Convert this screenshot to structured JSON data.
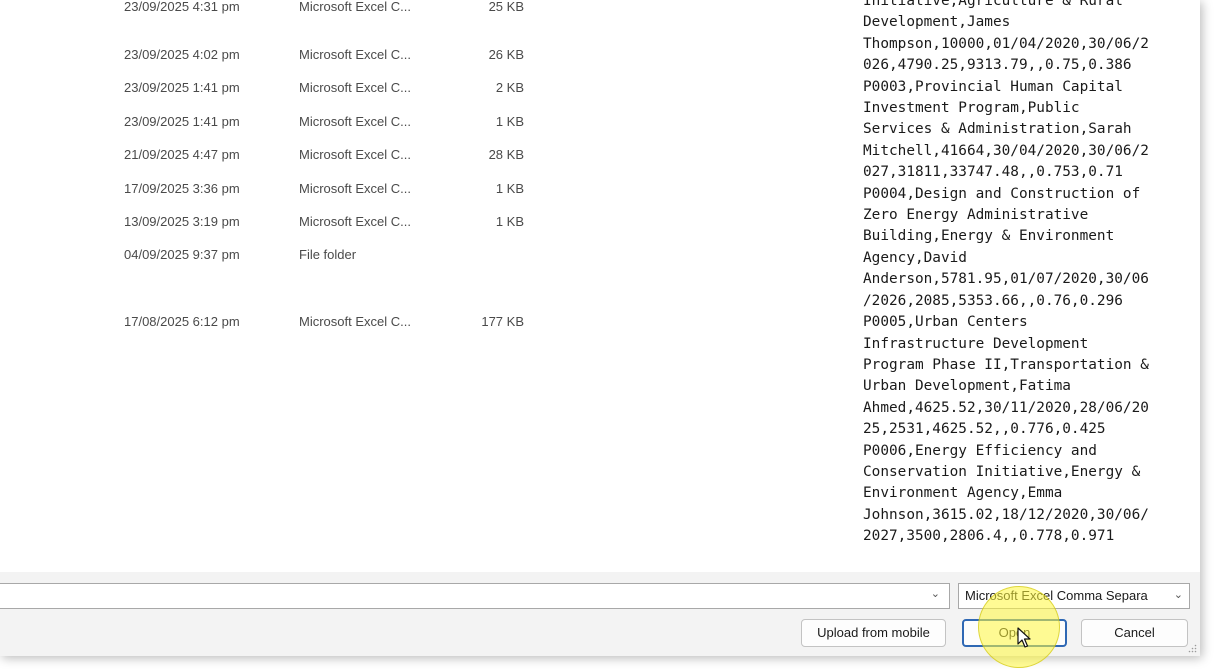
{
  "files": [
    {
      "date": "23/09/2025 4:31 pm",
      "type": "Microsoft Excel C...",
      "size": "25 KB"
    },
    {
      "date": "23/09/2025 4:02 pm",
      "type": "Microsoft Excel C...",
      "size": "26 KB"
    },
    {
      "date": "23/09/2025 1:41 pm",
      "type": "Microsoft Excel C...",
      "size": "2 KB"
    },
    {
      "date": "23/09/2025 1:41 pm",
      "type": "Microsoft Excel C...",
      "size": "1 KB"
    },
    {
      "date": "21/09/2025 4:47 pm",
      "type": "Microsoft Excel C...",
      "size": "28 KB"
    },
    {
      "date": "17/09/2025 3:36 pm",
      "type": "Microsoft Excel C...",
      "size": "1 KB"
    },
    {
      "date": "13/09/2025 3:19 pm",
      "type": "Microsoft Excel C...",
      "size": "1 KB"
    },
    {
      "date": "04/09/2025 9:37 pm",
      "type": "File folder",
      "size": ""
    },
    {
      "date": "17/08/2025 6:12 pm",
      "type": "Microsoft Excel C...",
      "size": "177 KB"
    }
  ],
  "preview": {
    "lines": [
      "Initiative,Agriculture & Rural",
      "Development,James",
      "Thompson,10000,01/04/2020,30/06/2",
      "026,4790.25,9313.79,,0.75,0.386",
      "P0003,Provincial Human Capital",
      "Investment Program,Public",
      "Services & Administration,Sarah",
      "Mitchell,41664,30/04/2020,30/06/2",
      "027,31811,33747.48,,0.753,0.71",
      "P0004,Design and Construction of",
      "Zero Energy Administrative",
      "Building,Energy & Environment",
      "Agency,David",
      "Anderson,5781.95,01/07/2020,30/06",
      "/2026,2085,5353.66,,0.76,0.296",
      "P0005,Urban Centers",
      "Infrastructure Development",
      "Program Phase II,Transportation &",
      "Urban Development,Fatima",
      "Ahmed,4625.52,30/11/2020,28/06/20",
      "25,2531,4625.52,,0.776,0.425",
      "P0006,Energy Efficiency and",
      "Conservation Initiative,Energy &",
      "Environment Agency,Emma",
      "Johnson,3615.02,18/12/2020,30/06/",
      "2027,3500,2806.4,,0.778,0.971"
    ]
  },
  "filename": {
    "value": ""
  },
  "filetype": {
    "selected": "Microsoft Excel Comma Separa"
  },
  "buttons": {
    "upload": "Upload from mobile",
    "open": "Open",
    "cancel": "Cancel"
  },
  "colors": {
    "accent": "#2f68b4",
    "highlight": "#fff83c"
  },
  "icons": {
    "dropdown": "chevron-down-icon",
    "cursor": "mouse-pointer-icon",
    "resize": "resize-grip-icon"
  }
}
